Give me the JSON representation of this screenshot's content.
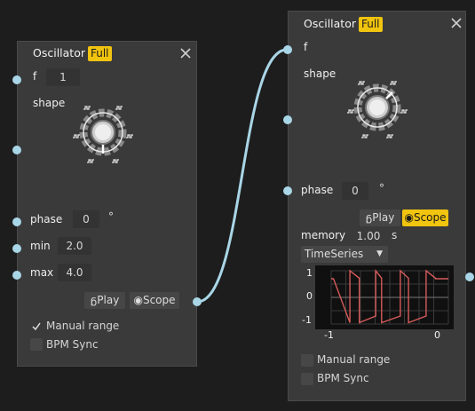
{
  "left_node": {
    "title": "Oscillator",
    "badge": "Full",
    "f_label": "f",
    "f_value": "1",
    "shape_label": "shape",
    "phase_label": "phase",
    "phase_value": "0",
    "phase_unit": "°",
    "min_label": "min",
    "min_value": "2.0",
    "max_label": "max",
    "max_value": "4.0",
    "play_label": "Play",
    "scope_label": "Scope",
    "manual_range_label": "Manual range",
    "manual_range_checked": true,
    "bpm_sync_label": "BPM Sync",
    "bpm_sync_checked": false
  },
  "right_node": {
    "title": "Oscillator",
    "badge": "Full",
    "f_label": "f",
    "shape_label": "shape",
    "phase_label": "phase",
    "phase_value": "0",
    "phase_unit": "°",
    "play_label": "Play",
    "scope_label": "Scope",
    "scope_active": true,
    "memory_label": "memory",
    "memory_value": "1.00",
    "memory_unit": "s",
    "plot_type": "TimeSeries",
    "manual_range_label": "Manual range",
    "manual_range_checked": false,
    "bpm_sync_label": "BPM Sync",
    "bpm_sync_checked": false
  },
  "colors": {
    "badge": "#f1c40f",
    "wire": "#a9d6e7",
    "scope_trace": "#d65a5a"
  },
  "chart_data": {
    "type": "line",
    "title": "",
    "xlabel": "",
    "ylabel": "",
    "xlim": [
      -1,
      0
    ],
    "ylim": [
      -1,
      1
    ],
    "x_ticks": [
      "-1",
      "0"
    ],
    "y_ticks": [
      "1",
      "0",
      "-1"
    ],
    "grid": true,
    "series": [
      {
        "x": [
          -1.0,
          -0.98,
          -0.98,
          -0.84,
          -0.84,
          -0.76,
          -0.76,
          -0.62,
          -0.62,
          -0.57,
          -0.57,
          -0.41,
          -0.41,
          -0.34,
          -0.34,
          -0.19,
          -0.19,
          -0.11,
          -0.11,
          0.0
        ],
        "y": [
          0.7,
          0.7,
          0.7,
          -0.95,
          1.0,
          0.72,
          -0.95,
          -0.7,
          1.0,
          0.72,
          -0.95,
          -0.7,
          1.0,
          0.72,
          -0.95,
          -0.7,
          1.0,
          0.72,
          0.7,
          0.7
        ]
      }
    ]
  }
}
